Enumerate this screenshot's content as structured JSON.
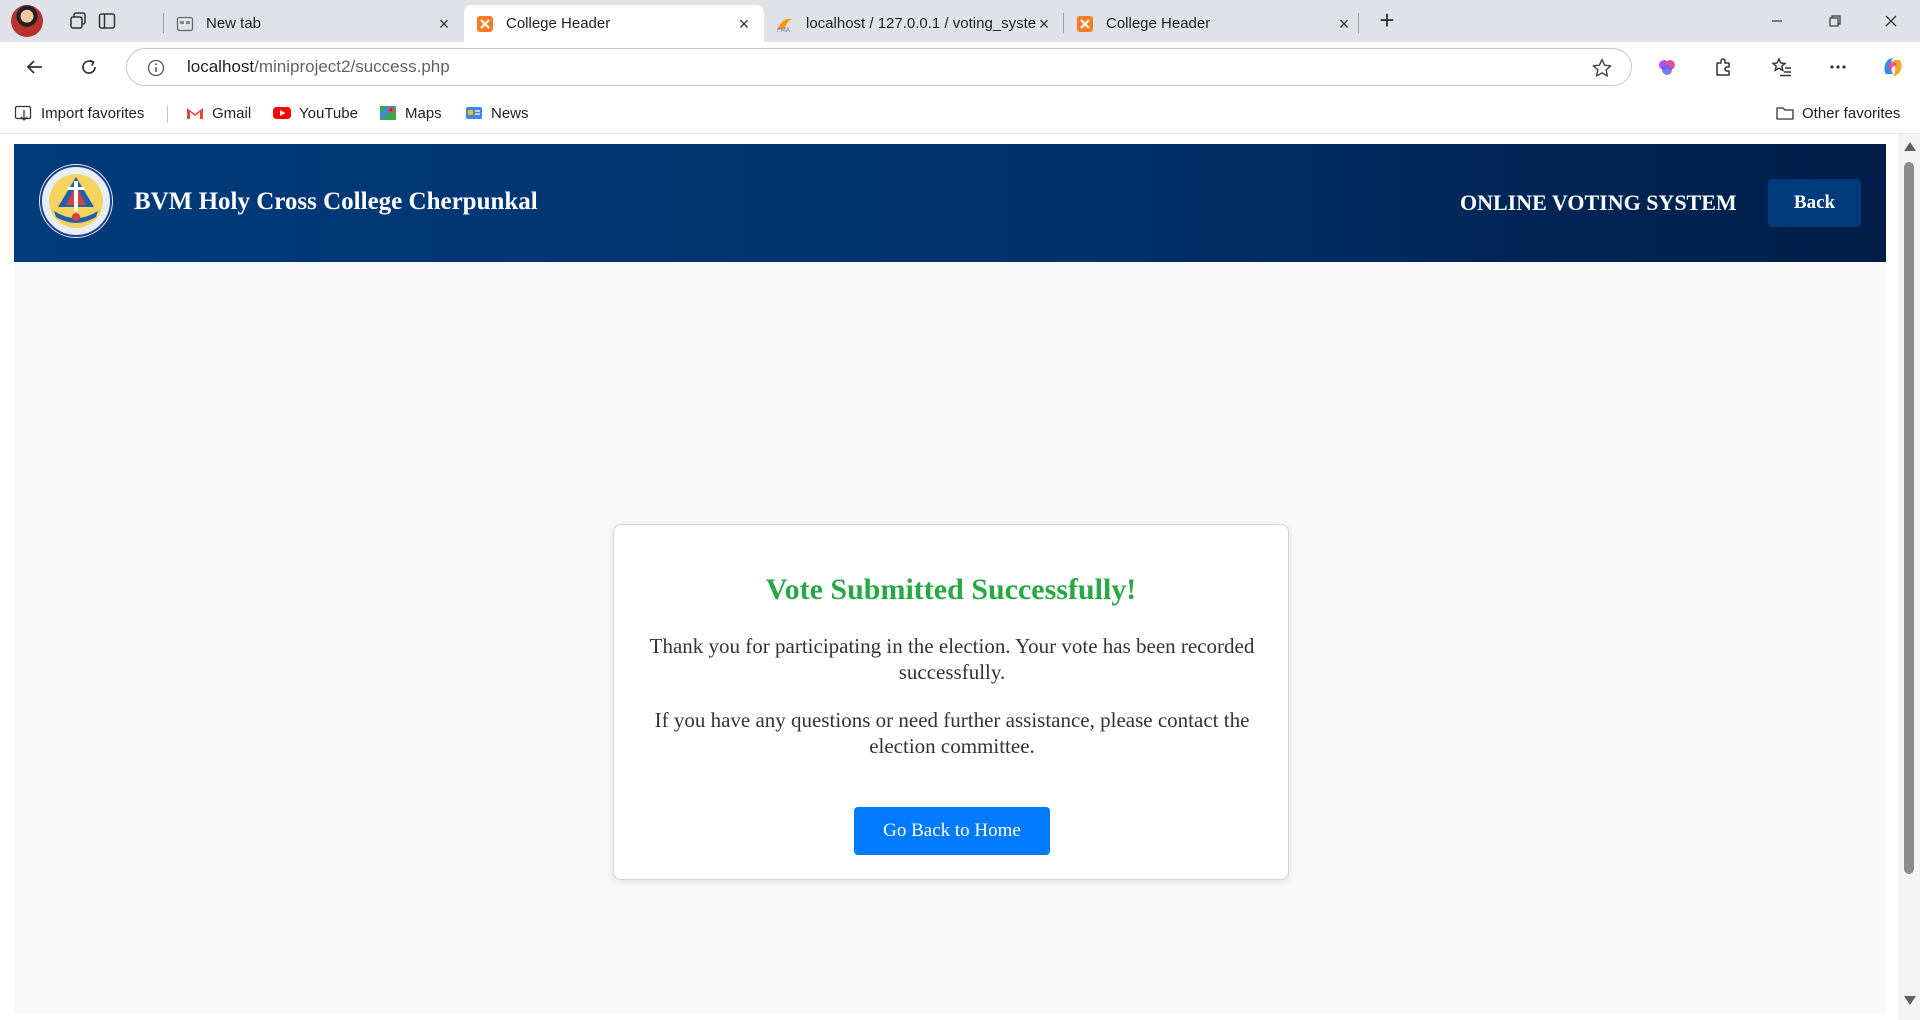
{
  "browser": {
    "tabs": [
      {
        "title": "New tab",
        "icon": "newtab-icon",
        "active": false
      },
      {
        "title": "College Header",
        "icon": "xampp-icon",
        "active": true
      },
      {
        "title": "localhost / 127.0.0.1 / voting_system",
        "icon": "phpmyadmin-icon",
        "active": false
      },
      {
        "title": "College Header",
        "icon": "xampp-icon",
        "active": false
      }
    ],
    "address": {
      "host": "localhost",
      "path": "/miniproject2/success.php"
    },
    "favorites": [
      {
        "label": "Import favorites",
        "icon": "import-icon"
      },
      {
        "label": "Gmail",
        "icon": "gmail-icon"
      },
      {
        "label": "YouTube",
        "icon": "youtube-icon"
      },
      {
        "label": "Maps",
        "icon": "maps-icon"
      },
      {
        "label": "News",
        "icon": "news-icon"
      }
    ],
    "other_favorites": "Other favorites"
  },
  "header": {
    "college_name": "BVM Holy Cross College Cherpunkal",
    "system_title": "ONLINE VOTING SYSTEM",
    "back_label": "Back"
  },
  "card": {
    "heading": "Vote Submitted Successfully!",
    "message1": "Thank you for participating in the election. Your vote has been recorded successfully.",
    "message2": "If you have any questions or need further assistance, please contact the election committee.",
    "button_label": "Go Back to Home"
  },
  "colors": {
    "header_start": "#003b7c",
    "header_end": "#001d48",
    "success_green": "#28a745",
    "primary_blue": "#007bff"
  }
}
